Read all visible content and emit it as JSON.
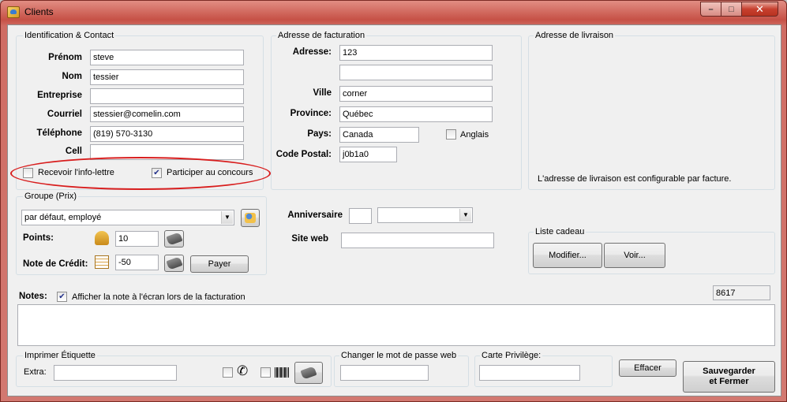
{
  "window": {
    "title": "Clients",
    "minimize": "–",
    "maximize": "□",
    "close": "✕"
  },
  "identification": {
    "title": "Identification & Contact",
    "prenom": {
      "label": "Prénom",
      "value": "steve"
    },
    "nom": {
      "label": "Nom",
      "value": "tessier"
    },
    "entreprise": {
      "label": "Entreprise",
      "value": ""
    },
    "courriel": {
      "label": "Courriel",
      "value": "stessier@comelin.com"
    },
    "telephone": {
      "label": "Téléphone",
      "value": "(819) 570-3130"
    },
    "cell": {
      "label": "Cell",
      "value": ""
    },
    "info_lettre": {
      "label": "Recevoir l'info-lettre",
      "checked": false
    },
    "concours": {
      "label": "Participer au concours",
      "checked": true
    }
  },
  "facturation": {
    "title": "Adresse de facturation",
    "adresse": {
      "label": "Adresse:",
      "line1": "123",
      "line2": ""
    },
    "ville": {
      "label": "Ville",
      "value": "corner"
    },
    "province": {
      "label": "Province:",
      "value": "Québec"
    },
    "pays": {
      "label": "Pays:",
      "value": "Canada"
    },
    "anglais": {
      "label": "Anglais",
      "checked": false
    },
    "code_postal": {
      "label": "Code Postal:",
      "value": "j0b1a0"
    }
  },
  "livraison": {
    "title": "Adresse de livraison",
    "note": "L'adresse de livraison est configurable par facture."
  },
  "groupe": {
    "title": "Groupe (Prix)",
    "selected": "par défaut, employé",
    "points": {
      "label": "Points:",
      "value": "10"
    },
    "credit": {
      "label": "Note de Crédit:",
      "value": "-50"
    },
    "payer": "Payer"
  },
  "anniversaire": {
    "label": "Anniversaire",
    "day": "",
    "month": ""
  },
  "site_web": {
    "label": "Site web",
    "value": ""
  },
  "liste_cadeau": {
    "title": "Liste cadeau",
    "modifier": "Modifier...",
    "voir": "Voir..."
  },
  "notes": {
    "label": "Notes:",
    "show_label": "Afficher la note à l'écran lors de la facturation",
    "show_checked": true,
    "id": "8617",
    "text": ""
  },
  "etiquette": {
    "title": "Imprimer Étiquette",
    "extra_label": "Extra:",
    "extra_value": "",
    "phone_checked": false,
    "barcode_checked": false
  },
  "mot_de_passe": {
    "title": "Changer le mot de passe web",
    "value": ""
  },
  "carte": {
    "title": "Carte Privilège:",
    "value": ""
  },
  "actions": {
    "effacer": "Effacer",
    "save_line1": "Sauvegarder",
    "save_line2": "et Fermer"
  },
  "colors": {
    "title_bar": "#c65146",
    "highlight": "#d81e1e",
    "window_bg": "#f0f0f0"
  }
}
